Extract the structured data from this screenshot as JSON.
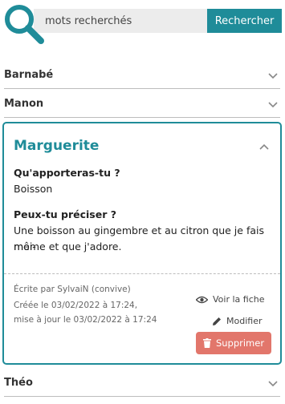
{
  "search": {
    "placeholder": "mots recherchés",
    "button_label": "Rechercher"
  },
  "accent_color": "#1f8c99",
  "delete_color": "#e2766b",
  "entries": [
    {
      "name": "Barnabé",
      "expanded": false
    },
    {
      "name": "Manon",
      "expanded": false
    },
    {
      "name": "Marguerite",
      "expanded": true
    },
    {
      "name": "Théo",
      "expanded": false
    }
  ],
  "card": {
    "name": "Marguerite",
    "question1": "Qu'apporteras-tu ?",
    "answer1": "Boisson",
    "question2": "Peux-tu préciser ?",
    "answer2_line1": "Une boisson au gingembre et au citron que je fais moi-",
    "answer2_line2": "même et que j'adore.",
    "meta_author": "Écrite par SylvaiN (convive)",
    "meta_created": "Créée le 03/02/2022 à 17:24,",
    "meta_updated": "mise à jour le 03/02/2022 à 17:24",
    "view_label": "Voir la fiche",
    "edit_label": "Modifier",
    "delete_label": "Supprimer"
  },
  "icons": {
    "search": "search-icon",
    "chevron_down": "chevron-down-icon",
    "chevron_up": "chevron-up-icon",
    "eye": "eye-icon",
    "pencil": "pencil-icon",
    "trash": "trash-icon"
  }
}
